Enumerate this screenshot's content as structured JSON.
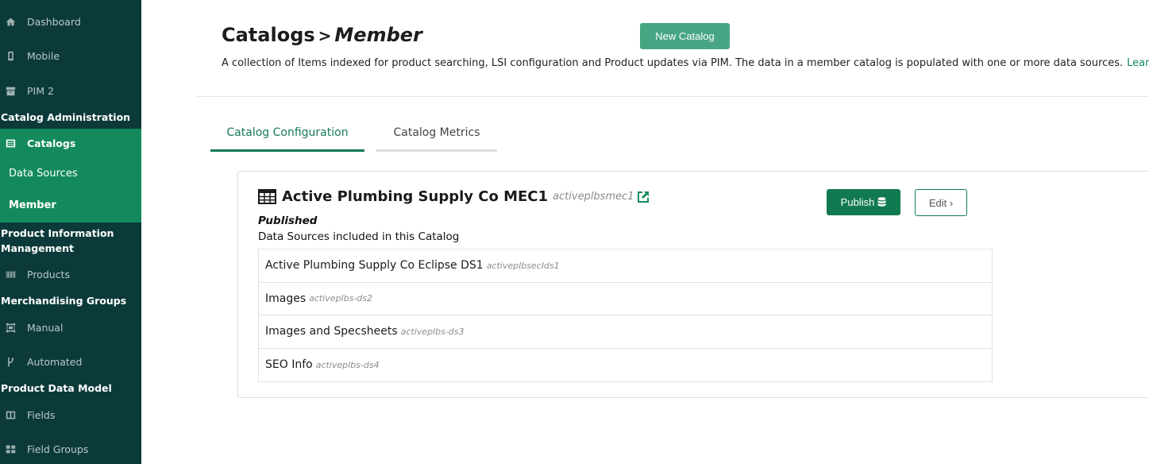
{
  "sidebar": {
    "items": [
      {
        "label": "Dashboard",
        "icon": "home-icon"
      },
      {
        "label": "Mobile",
        "icon": "mobile-icon"
      },
      {
        "label": "PIM 2",
        "icon": "archive-icon"
      }
    ],
    "sections": {
      "catalog_admin": "Catalog Administration",
      "pim": "Product Information Management",
      "merch": "Merchandising Groups",
      "data_model": "Product Data Model"
    },
    "catalogs": "Catalogs",
    "data_sources": "Data Sources",
    "member": "Member",
    "products": "Products",
    "manual": "Manual",
    "automated": "Automated",
    "fields": "Fields",
    "field_groups": "Field Groups"
  },
  "header": {
    "breadcrumb_root": "Catalogs",
    "breadcrumb_sep": ">",
    "breadcrumb_current": "Member",
    "new_catalog": "New Catalog",
    "description": "A collection of Items indexed for product searching, LSI configuration and Product updates via PIM. The data in a member catalog is populated with one or more data sources.",
    "learn_more": "Learn More"
  },
  "tabs": {
    "config": "Catalog Configuration",
    "metrics": "Catalog Metrics"
  },
  "card": {
    "name": "Active Plumbing Supply Co MEC1",
    "slug": "activeplbsmec1",
    "publish": "Publish",
    "edit": "Edit ›",
    "status": "Published",
    "ds_heading": "Data Sources included in this Catalog",
    "data_sources": [
      {
        "name": "Active Plumbing Supply Co Eclipse DS1",
        "slug": "activeplbsecIds1"
      },
      {
        "name": "Images",
        "slug": "activeplbs-ds2"
      },
      {
        "name": "Images and Specsheets",
        "slug": "activeplbs-ds3"
      },
      {
        "name": "SEO Info",
        "slug": "activeplbs-ds4"
      }
    ]
  },
  "colors": {
    "sidebar_bg": "#0c3a3a",
    "sidebar_active": "#148a5c",
    "accent": "#127a50",
    "new_catalog_bg": "#46a582"
  }
}
